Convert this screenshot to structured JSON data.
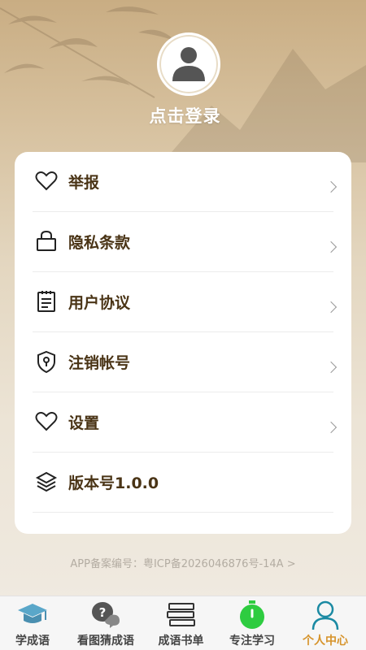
{
  "profile": {
    "login_text": "点击登录",
    "avatar_icon": "user-icon"
  },
  "menu": [
    {
      "label": "举报",
      "icon": "heart-icon"
    },
    {
      "label": "隐私条款",
      "icon": "lock-icon"
    },
    {
      "label": "用户协议",
      "icon": "document-icon"
    },
    {
      "label": "注销帐号",
      "icon": "shield-icon"
    },
    {
      "label": "设置",
      "icon": "heart-icon"
    },
    {
      "label": "版本号1.0.0",
      "icon": "layers-icon"
    }
  ],
  "icp_text": "APP备案编号：粤ICP备2026046876号-14A >",
  "tabs": [
    {
      "label": "学成语",
      "icon": "graduation-cap-icon"
    },
    {
      "label": "看图猜成语",
      "icon": "question-bubble-icon"
    },
    {
      "label": "成语书单",
      "icon": "book-stack-icon"
    },
    {
      "label": "专注学习",
      "icon": "stopwatch-icon"
    },
    {
      "label": "个人中心",
      "icon": "person-icon",
      "active": true
    }
  ],
  "colors": {
    "accent": "#d6932a",
    "menu_text": "#4a3416",
    "timer_green": "#2ecc40",
    "person_teal": "#1b8aa3"
  }
}
